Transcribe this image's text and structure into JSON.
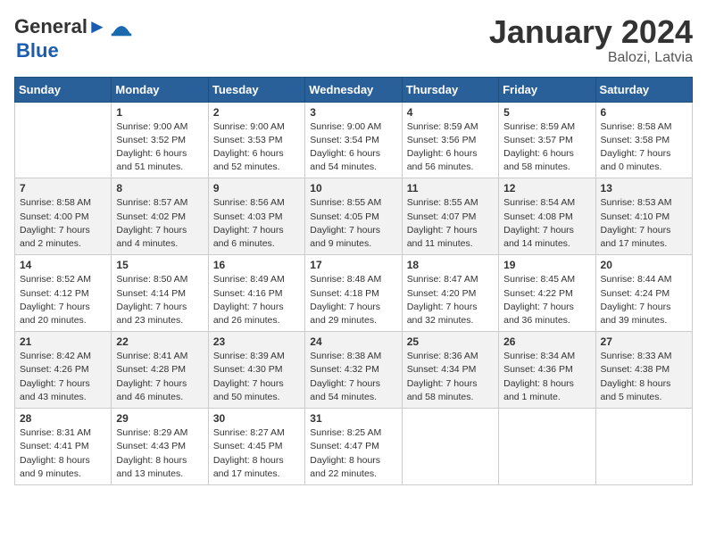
{
  "header": {
    "logo_line1": "General",
    "logo_line2": "Blue",
    "month_title": "January 2024",
    "location": "Balozi, Latvia"
  },
  "weekdays": [
    "Sunday",
    "Monday",
    "Tuesday",
    "Wednesday",
    "Thursday",
    "Friday",
    "Saturday"
  ],
  "weeks": [
    [
      {
        "day": "",
        "info": ""
      },
      {
        "day": "1",
        "info": "Sunrise: 9:00 AM\nSunset: 3:52 PM\nDaylight: 6 hours\nand 51 minutes."
      },
      {
        "day": "2",
        "info": "Sunrise: 9:00 AM\nSunset: 3:53 PM\nDaylight: 6 hours\nand 52 minutes."
      },
      {
        "day": "3",
        "info": "Sunrise: 9:00 AM\nSunset: 3:54 PM\nDaylight: 6 hours\nand 54 minutes."
      },
      {
        "day": "4",
        "info": "Sunrise: 8:59 AM\nSunset: 3:56 PM\nDaylight: 6 hours\nand 56 minutes."
      },
      {
        "day": "5",
        "info": "Sunrise: 8:59 AM\nSunset: 3:57 PM\nDaylight: 6 hours\nand 58 minutes."
      },
      {
        "day": "6",
        "info": "Sunrise: 8:58 AM\nSunset: 3:58 PM\nDaylight: 7 hours\nand 0 minutes."
      }
    ],
    [
      {
        "day": "7",
        "info": "Sunrise: 8:58 AM\nSunset: 4:00 PM\nDaylight: 7 hours\nand 2 minutes."
      },
      {
        "day": "8",
        "info": "Sunrise: 8:57 AM\nSunset: 4:02 PM\nDaylight: 7 hours\nand 4 minutes."
      },
      {
        "day": "9",
        "info": "Sunrise: 8:56 AM\nSunset: 4:03 PM\nDaylight: 7 hours\nand 6 minutes."
      },
      {
        "day": "10",
        "info": "Sunrise: 8:55 AM\nSunset: 4:05 PM\nDaylight: 7 hours\nand 9 minutes."
      },
      {
        "day": "11",
        "info": "Sunrise: 8:55 AM\nSunset: 4:07 PM\nDaylight: 7 hours\nand 11 minutes."
      },
      {
        "day": "12",
        "info": "Sunrise: 8:54 AM\nSunset: 4:08 PM\nDaylight: 7 hours\nand 14 minutes."
      },
      {
        "day": "13",
        "info": "Sunrise: 8:53 AM\nSunset: 4:10 PM\nDaylight: 7 hours\nand 17 minutes."
      }
    ],
    [
      {
        "day": "14",
        "info": "Sunrise: 8:52 AM\nSunset: 4:12 PM\nDaylight: 7 hours\nand 20 minutes."
      },
      {
        "day": "15",
        "info": "Sunrise: 8:50 AM\nSunset: 4:14 PM\nDaylight: 7 hours\nand 23 minutes."
      },
      {
        "day": "16",
        "info": "Sunrise: 8:49 AM\nSunset: 4:16 PM\nDaylight: 7 hours\nand 26 minutes."
      },
      {
        "day": "17",
        "info": "Sunrise: 8:48 AM\nSunset: 4:18 PM\nDaylight: 7 hours\nand 29 minutes."
      },
      {
        "day": "18",
        "info": "Sunrise: 8:47 AM\nSunset: 4:20 PM\nDaylight: 7 hours\nand 32 minutes."
      },
      {
        "day": "19",
        "info": "Sunrise: 8:45 AM\nSunset: 4:22 PM\nDaylight: 7 hours\nand 36 minutes."
      },
      {
        "day": "20",
        "info": "Sunrise: 8:44 AM\nSunset: 4:24 PM\nDaylight: 7 hours\nand 39 minutes."
      }
    ],
    [
      {
        "day": "21",
        "info": "Sunrise: 8:42 AM\nSunset: 4:26 PM\nDaylight: 7 hours\nand 43 minutes."
      },
      {
        "day": "22",
        "info": "Sunrise: 8:41 AM\nSunset: 4:28 PM\nDaylight: 7 hours\nand 46 minutes."
      },
      {
        "day": "23",
        "info": "Sunrise: 8:39 AM\nSunset: 4:30 PM\nDaylight: 7 hours\nand 50 minutes."
      },
      {
        "day": "24",
        "info": "Sunrise: 8:38 AM\nSunset: 4:32 PM\nDaylight: 7 hours\nand 54 minutes."
      },
      {
        "day": "25",
        "info": "Sunrise: 8:36 AM\nSunset: 4:34 PM\nDaylight: 7 hours\nand 58 minutes."
      },
      {
        "day": "26",
        "info": "Sunrise: 8:34 AM\nSunset: 4:36 PM\nDaylight: 8 hours\nand 1 minute."
      },
      {
        "day": "27",
        "info": "Sunrise: 8:33 AM\nSunset: 4:38 PM\nDaylight: 8 hours\nand 5 minutes."
      }
    ],
    [
      {
        "day": "28",
        "info": "Sunrise: 8:31 AM\nSunset: 4:41 PM\nDaylight: 8 hours\nand 9 minutes."
      },
      {
        "day": "29",
        "info": "Sunrise: 8:29 AM\nSunset: 4:43 PM\nDaylight: 8 hours\nand 13 minutes."
      },
      {
        "day": "30",
        "info": "Sunrise: 8:27 AM\nSunset: 4:45 PM\nDaylight: 8 hours\nand 17 minutes."
      },
      {
        "day": "31",
        "info": "Sunrise: 8:25 AM\nSunset: 4:47 PM\nDaylight: 8 hours\nand 22 minutes."
      },
      {
        "day": "",
        "info": ""
      },
      {
        "day": "",
        "info": ""
      },
      {
        "day": "",
        "info": ""
      }
    ]
  ]
}
